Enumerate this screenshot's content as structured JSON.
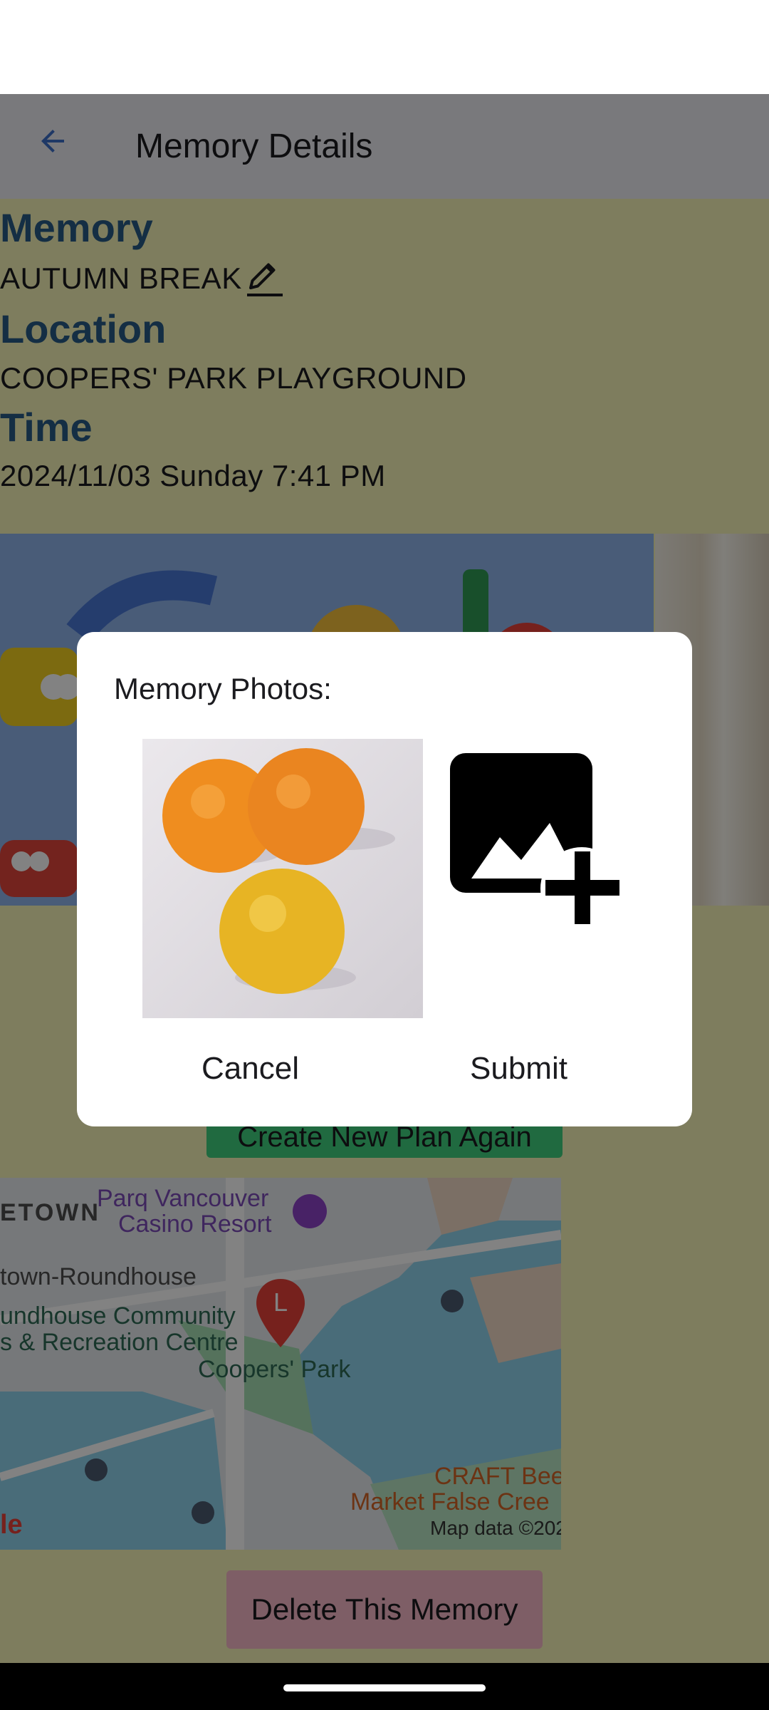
{
  "app_bar": {
    "title": "Memory Details"
  },
  "memory": {
    "memory_heading": "Memory",
    "memory_name": "AUTUMN BREAK",
    "location_heading": "Location",
    "location_name": "COOPERS' PARK PLAYGROUND",
    "time_heading": "Time",
    "time_value": "2024/11/03 Sunday 7:41 PM"
  },
  "buttons": {
    "create_plan": "Create New Plan Again",
    "delete_memory": "Delete This Memory"
  },
  "map": {
    "labels": [
      "ETOWN",
      "Parq Vancouver",
      "Casino Resort",
      "town-Roundhouse",
      "undhouse Community",
      "s & Recreation Centre",
      "Coopers' Park",
      "CRAFT Bee",
      "Market False Cree",
      "Map data ©202",
      "le"
    ],
    "marker_letter": "L"
  },
  "dialog": {
    "title": "Memory Photos:",
    "cancel": "Cancel",
    "submit": "Submit"
  },
  "colors": {
    "accent_blue": "#285a86",
    "create_button": "#3fd07e",
    "delete_button": "#f7b8c8",
    "content_bg": "#f8f5b8"
  },
  "icons": [
    "back-arrow-icon",
    "pencil-icon",
    "add-photo-icon",
    "map-marker-icon"
  ]
}
